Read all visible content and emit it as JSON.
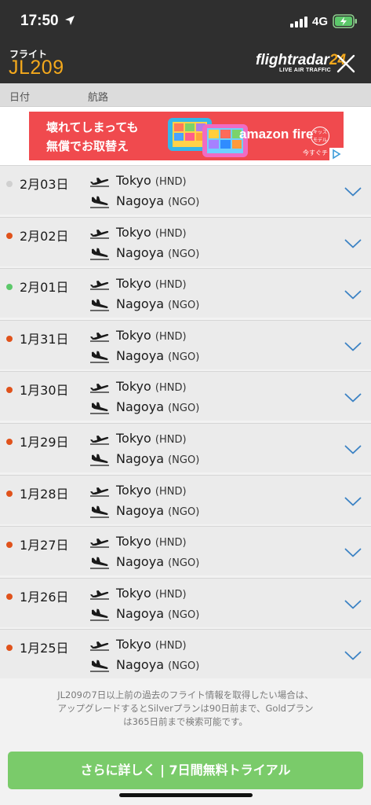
{
  "status_bar": {
    "time": "17:50",
    "network": "4G"
  },
  "header": {
    "subtitle": "フライト",
    "flight_number": "JL209",
    "logo_text_main": "flightradar",
    "logo_text_accent": "24",
    "logo_tagline": "LIVE AIR TRAFFIC"
  },
  "columns": {
    "date": "日付",
    "route": "航路"
  },
  "ad": {
    "line1": "壊れてしまっても",
    "line2": "無償でお取替え",
    "brand": "amazon fire",
    "badge": "キッズモデル",
    "cta": "今すぐチ"
  },
  "colors": {
    "header_bg": "#2f2f2f",
    "accent": "#f3a81c",
    "status_red": "#e0521b",
    "status_green": "#5cc86a",
    "status_gray": "#d0d0d0",
    "chevron": "#3b82c4",
    "cta_bg": "#7acb6a",
    "ad_bg": "#f04a4e"
  },
  "flights": [
    {
      "date": "2月03日",
      "status": "gray",
      "from_city": "Tokyo",
      "from_code": "(HND)",
      "to_city": "Nagoya",
      "to_code": "(NGO)"
    },
    {
      "date": "2月02日",
      "status": "red",
      "from_city": "Tokyo",
      "from_code": "(HND)",
      "to_city": "Nagoya",
      "to_code": "(NGO)"
    },
    {
      "date": "2月01日",
      "status": "green",
      "from_city": "Tokyo",
      "from_code": "(HND)",
      "to_city": "Nagoya",
      "to_code": "(NGO)"
    },
    {
      "date": "1月31日",
      "status": "red",
      "from_city": "Tokyo",
      "from_code": "(HND)",
      "to_city": "Nagoya",
      "to_code": "(NGO)"
    },
    {
      "date": "1月30日",
      "status": "red",
      "from_city": "Tokyo",
      "from_code": "(HND)",
      "to_city": "Nagoya",
      "to_code": "(NGO)"
    },
    {
      "date": "1月29日",
      "status": "red",
      "from_city": "Tokyo",
      "from_code": "(HND)",
      "to_city": "Nagoya",
      "to_code": "(NGO)"
    },
    {
      "date": "1月28日",
      "status": "red",
      "from_city": "Tokyo",
      "from_code": "(HND)",
      "to_city": "Nagoya",
      "to_code": "(NGO)"
    },
    {
      "date": "1月27日",
      "status": "red",
      "from_city": "Tokyo",
      "from_code": "(HND)",
      "to_city": "Nagoya",
      "to_code": "(NGO)"
    },
    {
      "date": "1月26日",
      "status": "red",
      "from_city": "Tokyo",
      "from_code": "(HND)",
      "to_city": "Nagoya",
      "to_code": "(NGO)"
    },
    {
      "date": "1月25日",
      "status": "red",
      "from_city": "Tokyo",
      "from_code": "(HND)",
      "to_city": "Nagoya",
      "to_code": "(NGO)"
    }
  ],
  "icons": {
    "departure": "plane-takeoff-icon",
    "arrival": "plane-landing-icon",
    "expand": "chevron-down-icon",
    "close": "close-icon"
  },
  "note_lines": [
    "JL209の7日以上前の過去のフライト情報を取得したい場合は、",
    "アップグレードするとSilverプランは90日前まで、Goldプラン",
    "は365日前まで検索可能です。"
  ],
  "cta_label": "さらに詳しく | 7日間無料トライアル"
}
